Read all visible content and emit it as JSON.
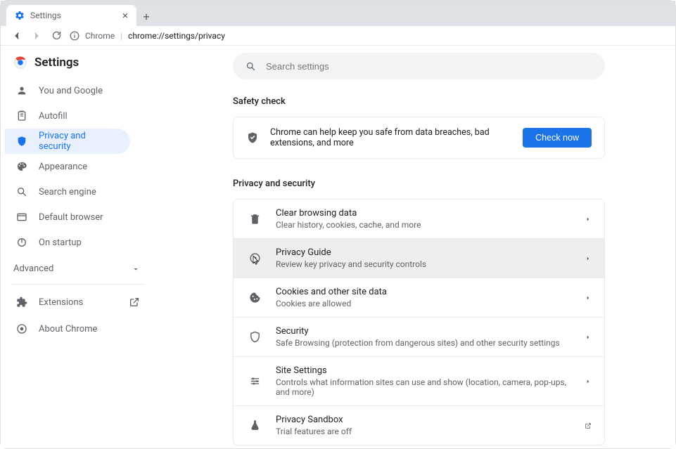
{
  "browser": {
    "tab_title": "Settings",
    "address_label": "Chrome",
    "address_url": "chrome://settings/privacy"
  },
  "header": {
    "title": "Settings"
  },
  "search": {
    "placeholder": "Search settings"
  },
  "sidebar": {
    "items": [
      {
        "icon": "user-icon",
        "label": "You and Google"
      },
      {
        "icon": "clipboard-icon",
        "label": "Autofill"
      },
      {
        "icon": "shield-icon",
        "label": "Privacy and security"
      },
      {
        "icon": "palette-icon",
        "label": "Appearance"
      },
      {
        "icon": "search-icon",
        "label": "Search engine"
      },
      {
        "icon": "browser-icon",
        "label": "Default browser"
      },
      {
        "icon": "power-icon",
        "label": "On startup"
      }
    ],
    "advanced_label": "Advanced",
    "extensions_label": "Extensions",
    "about_label": "About Chrome"
  },
  "safety": {
    "section_title": "Safety check",
    "text": "Chrome can help keep you safe from data breaches, bad extensions, and more",
    "button": "Check now"
  },
  "privacy": {
    "section_title": "Privacy and security",
    "rows": [
      {
        "icon": "trash-icon",
        "title": "Clear browsing data",
        "subtitle": "Clear history, cookies, cache, and more",
        "action": "chevron"
      },
      {
        "icon": "guide-icon",
        "title": "Privacy Guide",
        "subtitle": "Review key privacy and security controls",
        "action": "chevron",
        "hovered": true
      },
      {
        "icon": "cookie-icon",
        "title": "Cookies and other site data",
        "subtitle": "Cookies are allowed",
        "action": "chevron"
      },
      {
        "icon": "shield-icon",
        "title": "Security",
        "subtitle": "Safe Browsing (protection from dangerous sites) and other security settings",
        "action": "chevron"
      },
      {
        "icon": "sliders-icon",
        "title": "Site Settings",
        "subtitle": "Controls what information sites can use and show (location, camera, pop-ups, and more)",
        "action": "chevron"
      },
      {
        "icon": "flask-icon",
        "title": "Privacy Sandbox",
        "subtitle": "Trial features are off",
        "action": "external"
      }
    ]
  }
}
